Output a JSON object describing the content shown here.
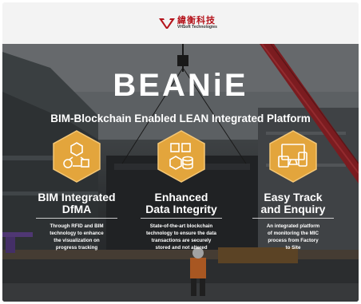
{
  "header": {
    "company_cn": "緯衡科技",
    "company_en": "VHSoft Technologies",
    "accent": "#b5141c"
  },
  "hero": {
    "brand": "BEANiE",
    "subtitle": "BIM-Blockchain Enabled LEAN Integrated Platform"
  },
  "features": [
    {
      "icon": "dfma-cycle-icon",
      "title_line1": "BIM Integrated",
      "title_line2": "DfMA",
      "desc_lines": [
        "Through RFID and BIM",
        "technology to enhance",
        "the visualization on",
        "progress tracking"
      ]
    },
    {
      "icon": "blockchain-database-icon",
      "title_line1": "Enhanced",
      "title_line2": "Data Integrity",
      "desc_lines": [
        "State-of-the-art blockchain",
        "technology to ensure the data",
        "transactions are securely",
        "stored and not altered"
      ]
    },
    {
      "icon": "devices-icon",
      "title_line1": "Easy Track",
      "title_line2": "and Enquiry",
      "desc_lines": [
        "An integrated platform",
        "of monitoring the MIC",
        "process from Factory",
        "to Site"
      ]
    }
  ],
  "colors": {
    "hexagon": "#e3a53c"
  }
}
